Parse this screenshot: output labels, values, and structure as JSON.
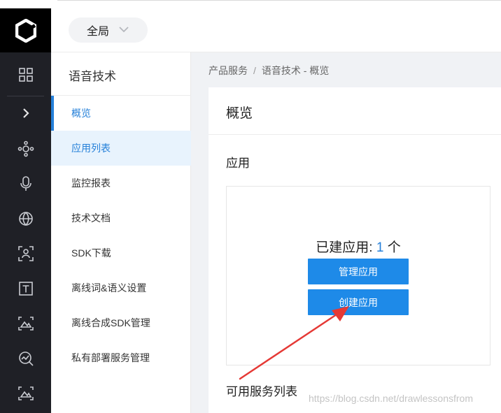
{
  "rail": {
    "icons": [
      "logo-icon",
      "grid-icon",
      "chevron-right-icon",
      "graph-icon",
      "mic-icon",
      "globe-icon",
      "scan-icon",
      "text-t-icon",
      "photo-icon",
      "search-chart-icon",
      "photo-icon"
    ]
  },
  "topbar": {
    "scope_label": "全局"
  },
  "sidenav": {
    "title": "语音技术",
    "items": [
      {
        "label": "概览"
      },
      {
        "label": "应用列表"
      },
      {
        "label": "监控报表"
      },
      {
        "label": "技术文档"
      },
      {
        "label": "SDK下载"
      },
      {
        "label": "离线词&语义设置"
      },
      {
        "label": "离线合成SDK管理"
      },
      {
        "label": "私有部署服务管理"
      }
    ]
  },
  "breadcrumb": {
    "root": "产品服务",
    "separator": "/",
    "current": "语音技术 - 概览"
  },
  "card": {
    "title": "概览",
    "section_apps": "应用",
    "created_prefix": "已建应用: ",
    "created_count": "1",
    "created_unit": " 个",
    "manage_button": "管理应用",
    "create_button": "创建应用",
    "section_services": "可用服务列表"
  },
  "colors": {
    "accent": "#2580d9",
    "button": "#1e8ae8",
    "rail_bg": "#1f2026",
    "annotation_arrow": "#e53935"
  },
  "watermark": "https://blog.csdn.net/drawlessonsfrom"
}
